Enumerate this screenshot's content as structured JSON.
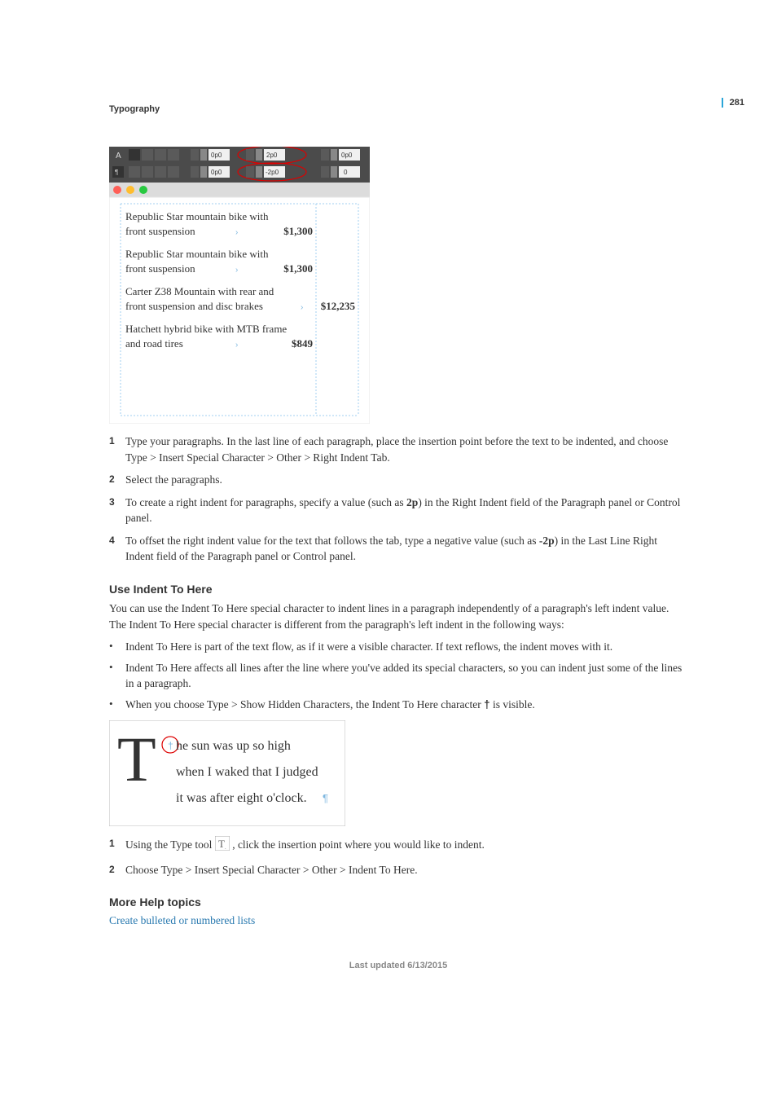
{
  "page_number": "281",
  "section_title": "Typography",
  "figure1": {
    "toolbar": {
      "left_indent_top": "0p0",
      "left_indent_bottom": "0p0",
      "right_indent_top": "2p0",
      "last_line_right_indent": "-2p0",
      "space_before": "0p0",
      "lines": "0"
    },
    "items": [
      {
        "desc": "Republic Star mountain bike with front suspension",
        "price": "$1,300"
      },
      {
        "desc": "Republic Star mountain bike with front suspension",
        "price": "$1,300"
      },
      {
        "desc": "Carter Z38 Mountain with rear and front suspension and disc brakes",
        "price": "$12,235"
      },
      {
        "desc": "Hatchett hybrid bike with MTB frame and road tires",
        "price": "$849"
      }
    ]
  },
  "steps1": [
    "Type your paragraphs. In the last line of each paragraph, place the insertion point before the text to be indented, and choose Type > Insert Special Character > Other > Right Indent Tab.",
    "Select the paragraphs.",
    "To create a right indent for paragraphs, specify a value (such as 2p) in the Right Indent field of the Paragraph panel or Control panel.",
    "To offset the right indent value for the text that follows the tab, type a negative value (such as -2p) in the Last Line Right Indent field of the Paragraph panel or Control panel."
  ],
  "subhead1": "Use Indent To Here",
  "para1": "You can use the Indent To Here special character to indent lines in a paragraph independently of a paragraph's left indent value. The Indent To Here special character is different from the paragraph's left indent in the following ways:",
  "bullets1": [
    "Indent To Here is part of the text flow, as if it were a visible character. If text reflows, the indent moves with it.",
    "Indent To Here affects all lines after the line where you've added its special characters, so you can indent just some of the lines in a paragraph.",
    "When you choose Type > Show Hidden Characters, the Indent To Here character "
  ],
  "bullet3_suffix": " is visible.",
  "figure2": {
    "line1": "he sun was up so high",
    "line2": "when I waked that I judged",
    "line3": "it was after eight o'clock."
  },
  "steps2_1a": "Using the Type tool ",
  "steps2_1b": " , click the insertion point where you would like to indent.",
  "steps2_2": "Choose Type > Insert Special Character > Other > Indent To Here.",
  "more_help": "More Help topics",
  "link1": "Create bulleted or numbered lists",
  "footer": "Last updated 6/13/2015"
}
